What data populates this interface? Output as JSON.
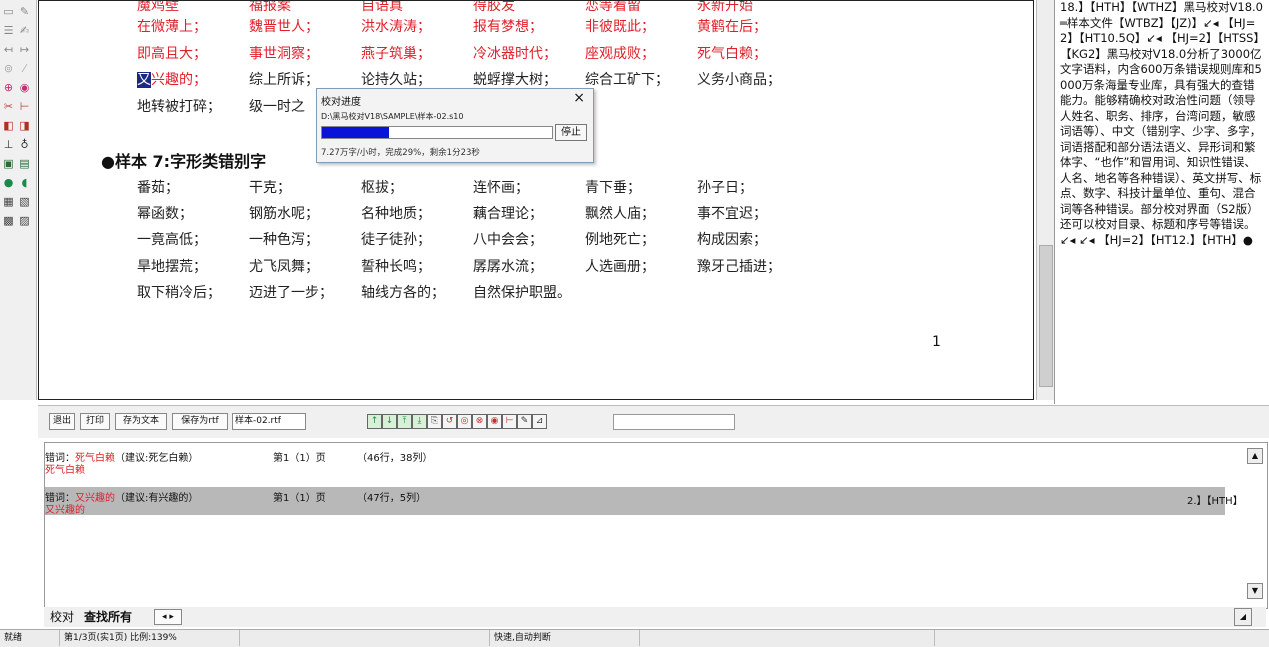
{
  "document": {
    "rows": [
      {
        "cells": [
          {
            "text": "魔鸡壁",
            "color": "#e0202a"
          },
          {
            "text": "福报案",
            "color": "#e0202a"
          },
          {
            "text": "自语真",
            "color": "#e0202a"
          },
          {
            "text": "得胶发",
            "color": "#e0202a"
          },
          {
            "text": "恋等看留",
            "color": "#e0202a"
          },
          {
            "text": "永新开始",
            "color": "#e0202a"
          }
        ]
      },
      {
        "cells": [
          {
            "text": "在微薄上；",
            "color": "#e0202a"
          },
          {
            "text": "魏晋世人；",
            "color": "#e0202a"
          },
          {
            "text": "洪水涛涛；",
            "color": "#e0202a"
          },
          {
            "text": "报有梦想；",
            "color": "#e0202a"
          },
          {
            "text": "非彼既此；",
            "color": "#e0202a"
          },
          {
            "text": "黄鹤在后；",
            "color": "#e0202a"
          }
        ]
      },
      {
        "cells": [
          {
            "text": "即高且大；",
            "color": "#e0202a"
          },
          {
            "text": "事世洞察；",
            "color": "#e0202a"
          },
          {
            "text": "燕子筑巢；",
            "color": "#e0202a"
          },
          {
            "text": "冷冰器时代；",
            "color": "#e0202a"
          },
          {
            "text": "座观成败；",
            "color": "#e0202a"
          },
          {
            "text": "死气白赖；",
            "color": "#e0202a"
          }
        ]
      },
      {
        "cells": [
          {
            "text": "又兴趣的；",
            "color": "#e0202a",
            "highlight_first": true
          },
          {
            "text": "综上所诉；",
            "color": "#222222"
          },
          {
            "text": "论持久站；",
            "color": "#222222"
          },
          {
            "text": "蜕蜉撑大树；",
            "color": "#222222"
          },
          {
            "text": "综合工矿下；",
            "color": "#222222"
          },
          {
            "text": "义务小商品；",
            "color": "#222222"
          }
        ]
      },
      {
        "cells": [
          {
            "text": "地转被打碎；",
            "color": "#222222"
          },
          {
            "text": "级一时之",
            "color": "#222222"
          }
        ]
      }
    ],
    "section_title": "●样本 7:字形类错别字",
    "rows2": [
      {
        "cells": [
          "番茹；",
          "干克；",
          "枢拔；",
          "连怀画；",
          "青下垂；",
          "孙子日；"
        ]
      },
      {
        "cells": [
          "幂函数；",
          "钢筋水呢；",
          "名种地质；",
          "藕合理论；",
          "飘然人庙；",
          "事不宜迟；"
        ]
      },
      {
        "cells": [
          "一竟高低；",
          "一种色泻；",
          "徒子徒孙；",
          "八中会会；",
          "例地死亡；",
          "构成因索；"
        ]
      },
      {
        "cells": [
          "旱地摆荒；",
          "尤飞凤舞；",
          "誓种长鸣；",
          "孱孱水流；",
          "人选画册；",
          "豫牙己插进；"
        ]
      },
      {
        "cells": [
          "取下稍冷后；",
          "迈进了一步；",
          "轴线方各的；",
          "自然保护职盟。"
        ]
      }
    ],
    "page_number": "1"
  },
  "right_panel": {
    "text": "18.】【HTH】【WTHZ】黑马校对V18.0═样本文件【WTBZ】【JZ)】↙◂ 【HJ=2】【HT10.5Q】↙◂ 【HJ=2】【HTSS】 【KG2】黑马校对V18.0分析了3000亿文字语料，内含600万条错误规则库和5000万条海量专业库，具有强大的查错能力。能够精确校对政治性问题（领导人姓名、职务、排序，台湾问题，敏感词语等）、中文（错别字、少字、多字，词语搭配和部分语法语义、异形词和繁体字、“也作”和冒用词、知识性错误、人名、地名等各种错误）、英文拼写、标点、数字、科技计量单位、重句、混合词等各种错误。部分校对界面（S2版）还可以校对目录、标题和序号等错误。↙◂ ↙◂ 【HJ=2】【HT12.】【HTH】●"
  },
  "dialog": {
    "title": "校对进度",
    "path": "D:\\黑马校对V18\\SAMPLE\\样本-02.s10",
    "progress_percent": 29,
    "stop_label": "停止",
    "status_text": "7.27万字/小时，完成29%，剩余1分23秒",
    "close_glyph": "×"
  },
  "toolbar": {
    "buttons": [
      "退出",
      "打印",
      "存为文本",
      "保存为rtf"
    ],
    "filename_field": "样本-02.rtf",
    "tool_icons": [
      "up-arrow-icon",
      "down-arrow-icon",
      "first-error-icon",
      "last-error-icon",
      "copy-icon",
      "replace-icon",
      "mark-icon",
      "delete-icon",
      "ignore-icon",
      "bookmark-icon",
      "edit-icon",
      "undo-icon"
    ],
    "tool_glyphs": [
      "↑",
      "↓",
      "⤒",
      "⤓",
      "⎘",
      "↺",
      "◎",
      "⊗",
      "◉",
      "⊢",
      "✎",
      "⊿"
    ],
    "tool_colors": [
      "#2a8a4a",
      "#2a8a4a",
      "#2a8a4a",
      "#2a8a4a",
      "#555555",
      "#c03030",
      "#c03030",
      "#c03030",
      "#c03030",
      "#c03030",
      "#333333",
      "#333333"
    ]
  },
  "results": [
    {
      "label": "错词：",
      "word": "死气白赖",
      "suggestion": "（建议:死乞白赖）",
      "page": "第1（1）页",
      "position": "（46行，38列）",
      "line2": "死气白赖",
      "selected": false
    },
    {
      "label": "错词：",
      "word": "又兴趣的",
      "suggestion": "（建议:有兴趣的）",
      "page": "第1（1）页",
      "position": "（47行，5列）",
      "line2": "又兴趣的",
      "selected": true
    }
  ],
  "results_fragment": "2.】【HTH】",
  "tabs": [
    "校对",
    "查找所有"
  ],
  "tab_nav": "◂ ▸",
  "status": {
    "left": "就绪",
    "page_info": "第1/3页(实1页) 比例:139%",
    "mode": "快速,自动判断"
  },
  "colors": {
    "accent_progress": "#0a14d8",
    "error_red": "#e0202a"
  }
}
